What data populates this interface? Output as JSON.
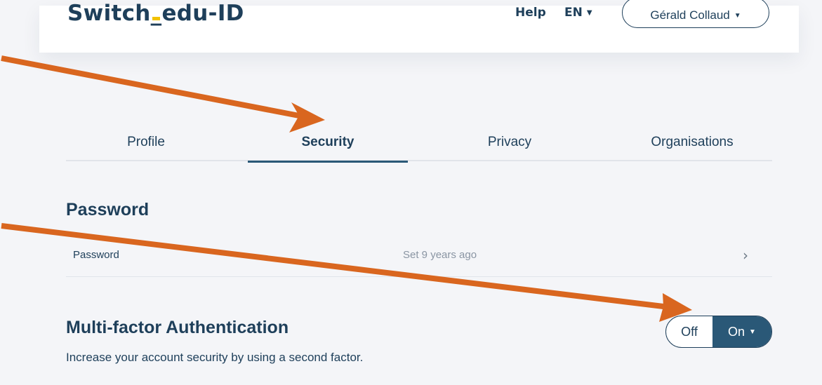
{
  "header": {
    "logo_main": "Switch",
    "logo_underscore": "_",
    "logo_suffix": "edu-ID",
    "help_label": "Help",
    "language": "EN",
    "user_name": "Gérald Collaud"
  },
  "tabs": [
    {
      "label": "Profile",
      "active": false
    },
    {
      "label": "Security",
      "active": true
    },
    {
      "label": "Privacy",
      "active": false
    },
    {
      "label": "Organisations",
      "active": false
    }
  ],
  "password_section": {
    "title": "Password",
    "row_label": "Password",
    "row_value": "Set 9 years ago",
    "chevron": "chevron-right-icon"
  },
  "mfa_section": {
    "title": "Multi-factor Authentication",
    "description": "Increase your account security by using a second factor.",
    "toggle_off": "Off",
    "toggle_on": "On",
    "state": "On"
  },
  "colors": {
    "brand_dark": "#1e3f5a",
    "accent_blue": "#2a5877",
    "logo_yellow": "#f2c200",
    "annotation_arrow": "#d9661f",
    "background": "#f4f5f8"
  }
}
